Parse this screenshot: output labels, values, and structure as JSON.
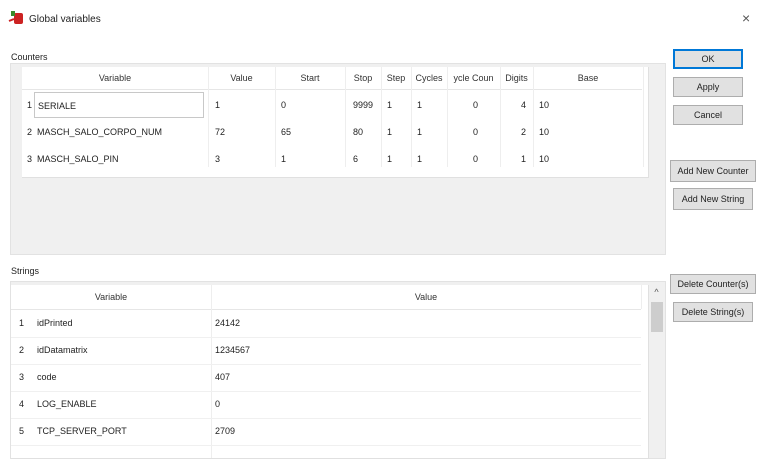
{
  "window": {
    "title": "Global variables",
    "close_symbol": "×"
  },
  "counters": {
    "section_label": "Counters",
    "columns": [
      "Variable",
      "Value",
      "Start",
      "Stop",
      "Step",
      "Cycles",
      "ycle Coun",
      "Digits",
      "Base"
    ],
    "rows": [
      {
        "num": "1",
        "cells": [
          "SERIALE",
          "1",
          "0",
          "9999",
          "1",
          "1",
          "0",
          "4",
          "10"
        ]
      },
      {
        "num": "2",
        "cells": [
          "MASCH_SALO_CORPO_NUM",
          "72",
          "65",
          "80",
          "1",
          "1",
          "0",
          "2",
          "10"
        ]
      },
      {
        "num": "3",
        "cells": [
          "MASCH_SALO_PIN",
          "3",
          "1",
          "6",
          "1",
          "1",
          "0",
          "1",
          "10"
        ]
      }
    ]
  },
  "strings": {
    "section_label": "Strings",
    "columns": [
      "Variable",
      "Value"
    ],
    "rows": [
      {
        "num": "1",
        "variable": "idPrinted",
        "value": "24142"
      },
      {
        "num": "2",
        "variable": "idDatamatrix",
        "value": "1234567"
      },
      {
        "num": "3",
        "variable": "code",
        "value": "407"
      },
      {
        "num": "4",
        "variable": "LOG_ENABLE",
        "value": "0"
      },
      {
        "num": "5",
        "variable": "TCP_SERVER_PORT",
        "value": "2709"
      }
    ]
  },
  "buttons": {
    "ok": "OK",
    "apply": "Apply",
    "cancel": "Cancel",
    "add_counter": "Add New Counter",
    "add_string": "Add New String",
    "delete_counter": "Delete Counter(s)",
    "delete_string": "Delete String(s)"
  },
  "scrollbar": {
    "up_arrow": "^"
  },
  "colors": {
    "app_icon_red": "#cc2222",
    "app_icon_green": "#3a8a2a",
    "ok_border": "#0078d7"
  }
}
